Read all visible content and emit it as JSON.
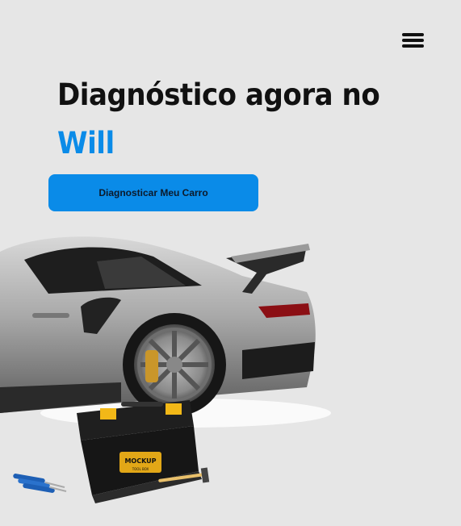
{
  "header": {
    "menu_icon": "hamburger-menu-icon"
  },
  "hero": {
    "headline": "Diagnóstico agora no",
    "brand": "Will",
    "brand_color": "#0a8be8",
    "cta_label": "Diagnosticar Meu Carro"
  },
  "illustration": {
    "toolbox_label_1": "MOCKUP",
    "toolbox_label_2": "TOOL BOX"
  }
}
